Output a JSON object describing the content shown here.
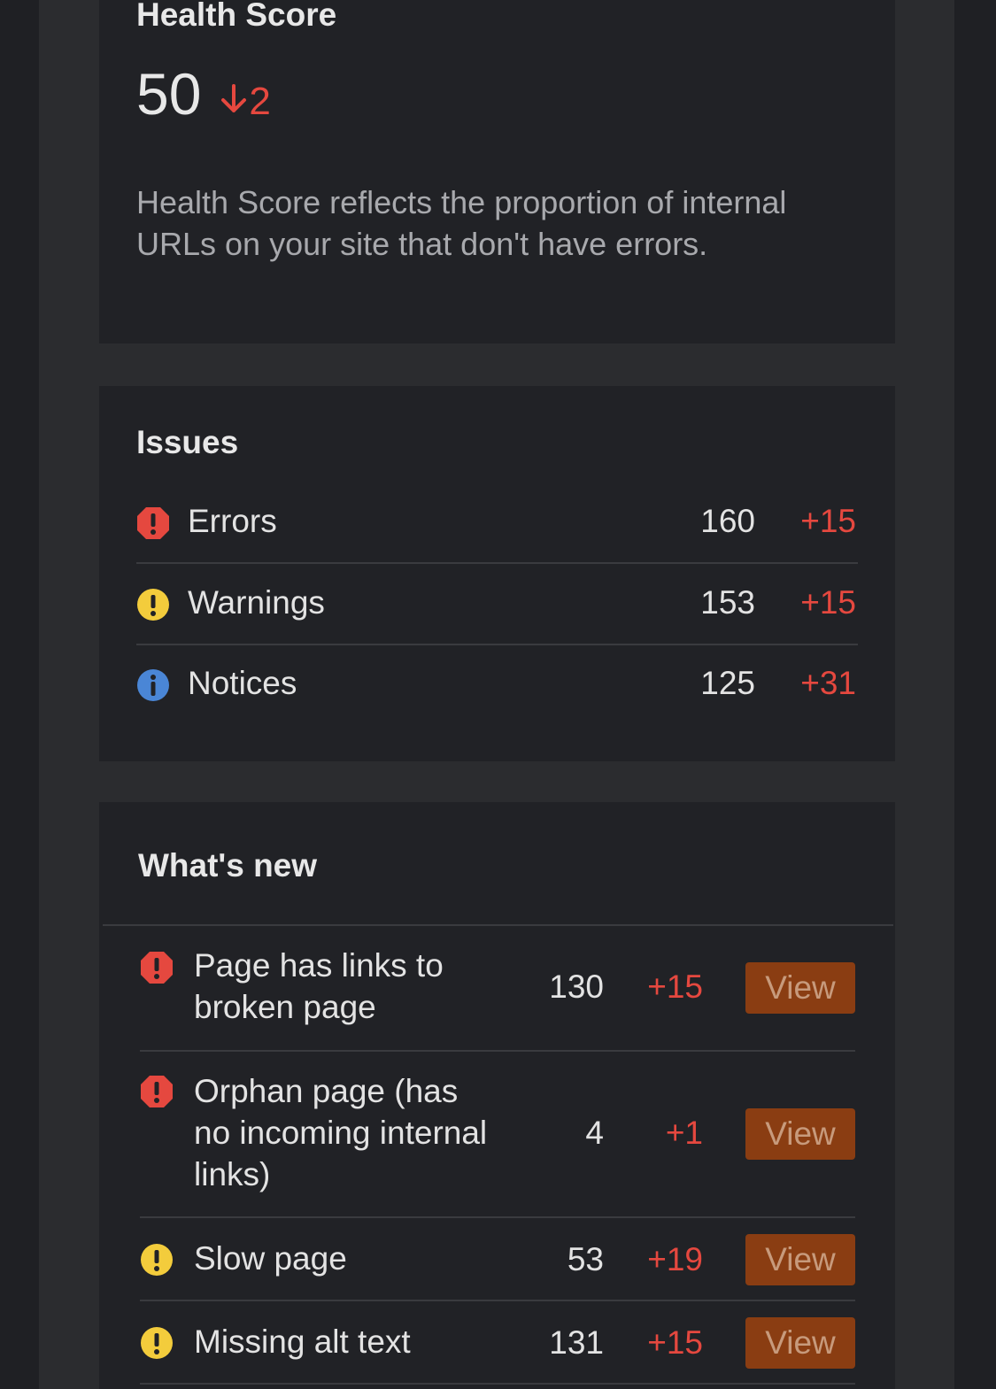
{
  "health": {
    "title": "Health Score",
    "score": "50",
    "delta": "2",
    "description": "Health Score reflects the proportion of internal URLs on your site that don't have errors."
  },
  "issues": {
    "title": "Issues",
    "rows": [
      {
        "icon": "error-icon",
        "label": "Errors",
        "count": "160",
        "delta": "+15"
      },
      {
        "icon": "warning-icon",
        "label": "Warnings",
        "count": "153",
        "delta": "+15"
      },
      {
        "icon": "info-icon",
        "label": "Notices",
        "count": "125",
        "delta": "+31"
      }
    ]
  },
  "whats_new": {
    "title": "What's new",
    "rows": [
      {
        "icon": "error-icon",
        "label": "Page has links to broken page",
        "count": "130",
        "delta": "+15",
        "button": "View"
      },
      {
        "icon": "error-icon",
        "label": "Orphan page (has no incoming internal links)",
        "count": "4",
        "delta": "+1",
        "button": "View"
      },
      {
        "icon": "warning-icon",
        "label": "Slow page",
        "count": "53",
        "delta": "+19",
        "button": "View"
      },
      {
        "icon": "warning-icon",
        "label": "Missing alt text",
        "count": "131",
        "delta": "+15",
        "button": "View"
      }
    ]
  },
  "colors": {
    "error": "#e5483f",
    "warning": "#f3cc3c",
    "info": "#4a86d6",
    "button": "#8a3d12"
  }
}
